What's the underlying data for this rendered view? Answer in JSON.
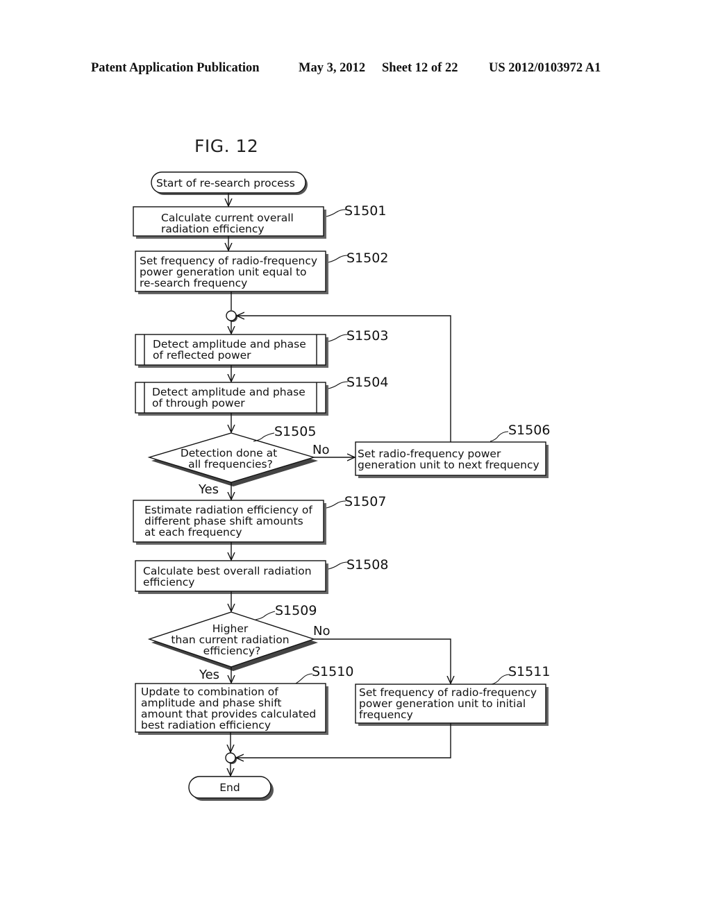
{
  "header": {
    "publication": "Patent Application Publication",
    "date": "May 3, 2012",
    "sheet": "Sheet 12 of 22",
    "number": "US 2012/0103972 A1"
  },
  "figure": {
    "title": "FIG. 12"
  },
  "flowchart": {
    "start": "Start of re-search process",
    "end": "End",
    "steps": {
      "s1501": {
        "id": "S1501",
        "lines": [
          "Calculate current overall",
          "radiation efficiency"
        ]
      },
      "s1502": {
        "id": "S1502",
        "lines": [
          "Set frequency of radio-frequency",
          "power generation unit equal to",
          "re-search frequency"
        ]
      },
      "s1503": {
        "id": "S1503",
        "lines": [
          "Detect amplitude and phase",
          "of reflected power"
        ]
      },
      "s1504": {
        "id": "S1504",
        "lines": [
          "Detect amplitude and phase",
          "of through power"
        ]
      },
      "s1505": {
        "id": "S1505",
        "lines": [
          "Detection done at",
          "all frequencies?"
        ],
        "yes": "Yes",
        "no": "No"
      },
      "s1506": {
        "id": "S1506",
        "lines": [
          "Set radio-frequency power",
          "generation unit to next frequency"
        ]
      },
      "s1507": {
        "id": "S1507",
        "lines": [
          "Estimate radiation efficiency of",
          "different phase shift amounts",
          "at each frequency"
        ]
      },
      "s1508": {
        "id": "S1508",
        "lines": [
          "Calculate best overall radiation",
          "efficiency"
        ]
      },
      "s1509": {
        "id": "S1509",
        "lines": [
          "Higher",
          "than current radiation",
          "efficiency?"
        ],
        "yes": "Yes",
        "no": "No"
      },
      "s1510": {
        "id": "S1510",
        "lines": [
          "Update to combination of",
          "amplitude and phase shift",
          "amount that provides calculated",
          "best radiation efficiency"
        ]
      },
      "s1511": {
        "id": "S1511",
        "lines": [
          "Set frequency of radio-frequency",
          "power generation unit to initial",
          "frequency"
        ]
      }
    }
  }
}
